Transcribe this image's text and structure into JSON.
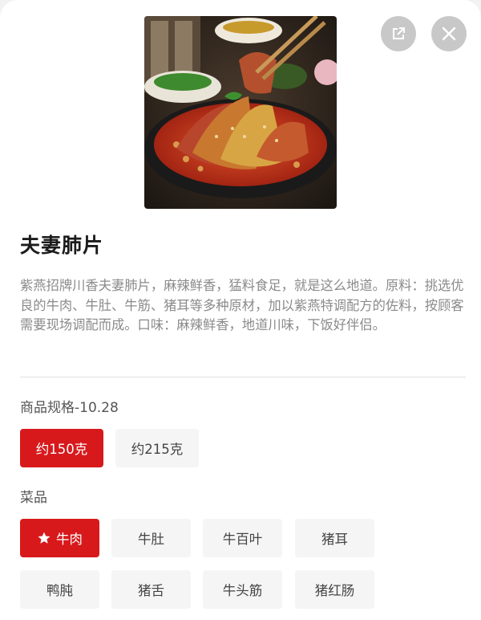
{
  "product": {
    "title": "夫妻肺片",
    "description": "紫燕招牌川香夫妻肺片，麻辣鲜香，猛料食足，就是这么地道。原料：挑选优良的牛肉、牛肚、牛筋、猪耳等多种原材，加以紫燕特调配方的佐料，按顾客需要现场调配而成。口味：麻辣鲜香，地道川味，下饭好伴侣。"
  },
  "icons": {
    "share": "share-icon",
    "close": "close-icon",
    "selected_marker": "star-icon"
  },
  "colors": {
    "accent": "#d7191c",
    "chip_background": "#f5f5f5",
    "icon_button_background": "#c8c8c8"
  },
  "spec": {
    "label": "商品规格-10.28",
    "options": [
      {
        "label": "约150克",
        "selected": true
      },
      {
        "label": "约215克",
        "selected": false
      }
    ]
  },
  "dishes": {
    "label": "菜品",
    "options": [
      {
        "label": "牛肉",
        "selected": true
      },
      {
        "label": "牛肚",
        "selected": false
      },
      {
        "label": "牛百叶",
        "selected": false
      },
      {
        "label": "猪耳",
        "selected": false
      },
      {
        "label": "鸭肫",
        "selected": false
      },
      {
        "label": "猪舌",
        "selected": false
      },
      {
        "label": "牛头筋",
        "selected": false
      },
      {
        "label": "猪红肠",
        "selected": false
      }
    ]
  }
}
